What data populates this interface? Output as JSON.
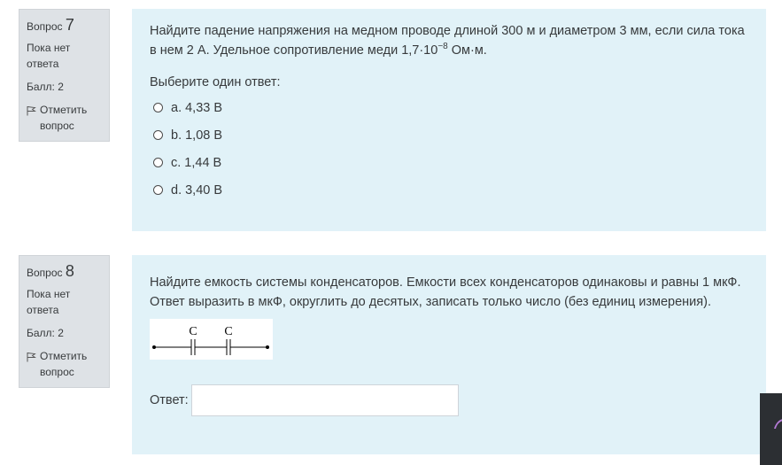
{
  "q7": {
    "label": "Вопрос",
    "number": "7",
    "state": "Пока нет ответа",
    "grade": "Балл: 2",
    "flag": "Отметить вопрос",
    "text_main": "Найдите падение напряжения на медном проводе длиной 300 м и диаметром 3 мм, если сила тока в нем 2 А. Удельное сопротивление меди 1,7·10",
    "text_exp": "−8",
    "text_unit": " Ом·м.",
    "prompt": "Выберите один ответ:",
    "options": [
      "a. 4,33 В",
      "b. 1,08 В",
      "c. 1,44 В",
      "d. 3,40 В"
    ]
  },
  "q8": {
    "label": "Вопрос",
    "number": "8",
    "state": "Пока нет ответа",
    "grade": "Балл: 2",
    "flag": "Отметить вопрос",
    "text": "Найдите емкость системы конденсаторов. Емкости всех конденсаторов одинаковы и равны 1 мкФ. Ответ выразить в мкФ, округлить до десятых, записать только число (без единиц измерения).",
    "circuit_labels": [
      "C",
      "C"
    ],
    "answer_label": "Ответ:",
    "answer_value": ""
  },
  "icons": {
    "flag": "flag-icon",
    "radio": "radio-button"
  }
}
